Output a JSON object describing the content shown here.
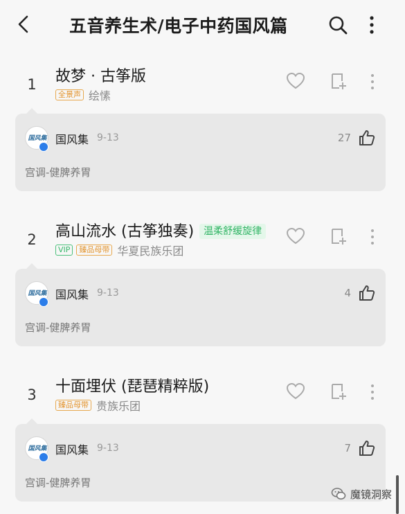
{
  "header": {
    "title": "五音养生术/电子中药国风篇"
  },
  "songs": [
    {
      "index": "1",
      "title": "故梦 · 古筝版",
      "tags": [
        "全景声"
      ],
      "artist": "绘愫",
      "extra_badge": "",
      "comment": {
        "author": "国风集",
        "date": "9-13",
        "likes": "27",
        "text": "宫调-健脾养胃"
      }
    },
    {
      "index": "2",
      "title": "高山流水 (古筝独奏)",
      "tags": [
        "VIP",
        "臻品母带"
      ],
      "artist": "华夏民族乐团",
      "extra_badge": "温柔舒缓旋律",
      "comment": {
        "author": "国风集",
        "date": "9-13",
        "likes": "4",
        "text": "宫调-健脾养胃"
      }
    },
    {
      "index": "3",
      "title": "十面埋伏 (琵琶精粹版)",
      "tags": [
        "臻品母带"
      ],
      "artist": "贵族乐团",
      "extra_badge": "",
      "comment": {
        "author": "国风集",
        "date": "9-13",
        "likes": "7",
        "text": "宫调-健脾养胃"
      }
    }
  ],
  "avatar_text": "国风集",
  "watermark": "魔镜洞察",
  "colors": {
    "tag_orange": "#e3952f",
    "tag_green": "#35b86a",
    "card_bg": "#e8e8e8",
    "page_bg": "#f7f7f7"
  }
}
